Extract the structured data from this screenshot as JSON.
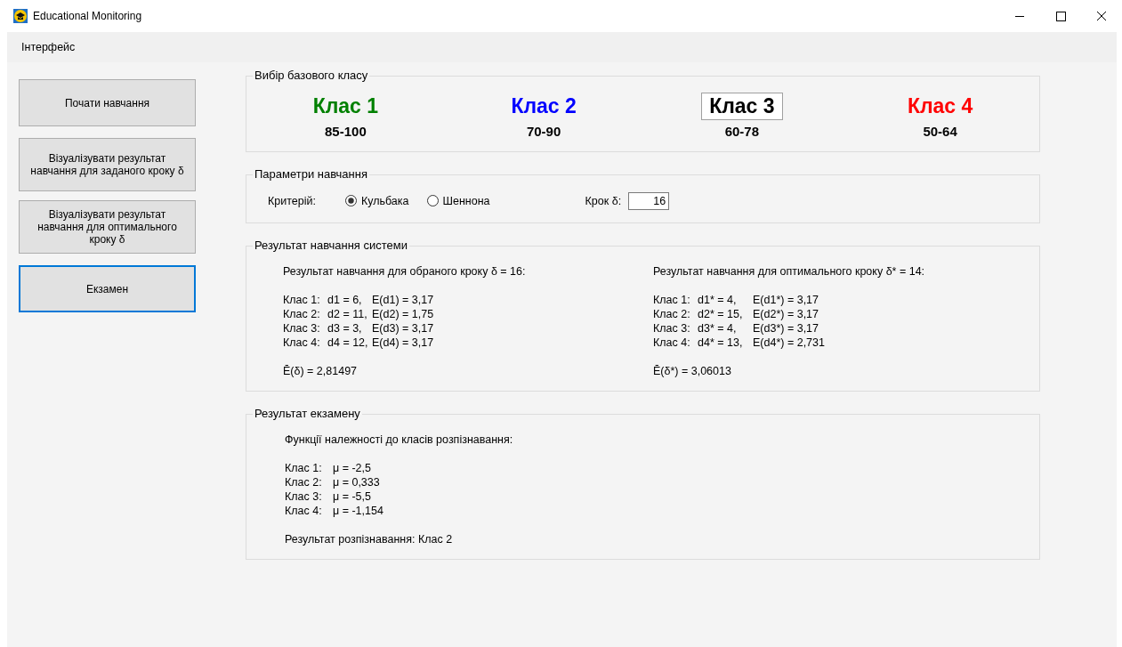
{
  "window": {
    "title": "Educational Monitoring"
  },
  "menu": [
    {
      "label": "Інтерфейс"
    }
  ],
  "buttons": [
    {
      "label": "Почати навчання",
      "focused": false
    },
    {
      "label": "Візуалізувати результат навчання для заданого кроку  δ",
      "focused": false
    },
    {
      "label": "Візуалізувати результат навчання для оптимального кроку  δ",
      "focused": false
    },
    {
      "label": "Екзамен",
      "focused": true
    }
  ],
  "base_class": {
    "title": "Вибір базового класу",
    "classes": [
      {
        "name": "Клас 1",
        "range": "85-100",
        "color": "#008000",
        "selected": false
      },
      {
        "name": "Клас 2",
        "range": "70-90",
        "color": "#0000ff",
        "selected": false
      },
      {
        "name": "Клас 3",
        "range": "60-78",
        "color": "#000000",
        "selected": true
      },
      {
        "name": "Клас 4",
        "range": "50-64",
        "color": "#ff0000",
        "selected": false
      }
    ]
  },
  "params": {
    "title": "Параметри навчання",
    "criterion_label": "Критерій:",
    "criteria": [
      {
        "label": "Кульбака",
        "selected": true
      },
      {
        "label": "Шеннона",
        "selected": false
      }
    ],
    "step_label": "Крок δ:",
    "step_value": "16"
  },
  "training": {
    "title": "Результат навчання системи",
    "columns": [
      {
        "heading": "Результат навчання для обраного кроку δ  = 16:",
        "rows": [
          {
            "label": "Клас 1:",
            "d": "d1 = 6,",
            "e": "E(d1) = 3,17"
          },
          {
            "label": "Клас 2:",
            "d": "d2 = 11,",
            "e": "E(d2) = 1,75"
          },
          {
            "label": "Клас 3:",
            "d": "d3 = 3,",
            "e": "E(d3) = 3,17"
          },
          {
            "label": "Клас 4:",
            "d": "d4 = 12,",
            "e": "E(d4) = 3,17"
          }
        ],
        "total": "Ē(δ) = 2,81497"
      },
      {
        "heading": "Результат навчання для оптимального кроку δ* = 14:",
        "rows": [
          {
            "label": "Клас 1:",
            "d": "d1* = 4,",
            "e": "E(d1*) = 3,17"
          },
          {
            "label": "Клас 2:",
            "d": "d2* = 15,",
            "e": "E(d2*) = 3,17"
          },
          {
            "label": "Клас 3:",
            "d": "d3* = 4,",
            "e": "E(d3*) = 3,17"
          },
          {
            "label": "Клас 4:",
            "d": "d4* = 13,",
            "e": "E(d4*) = 2,731"
          }
        ],
        "total": "Ē(δ*) = 3,06013"
      }
    ]
  },
  "exam": {
    "title": "Результат екзамену",
    "heading": "Функції належності до класів розпізнавання:",
    "rows": [
      {
        "label": "Клас 1:",
        "mu": "μ = -2,5"
      },
      {
        "label": "Клас 2:",
        "mu": "μ = 0,333"
      },
      {
        "label": "Клас 3:",
        "mu": "μ = -5,5"
      },
      {
        "label": "Клас 4:",
        "mu": "μ = -1,154"
      }
    ],
    "result": "Результат розпізнавання: Клас 2"
  }
}
